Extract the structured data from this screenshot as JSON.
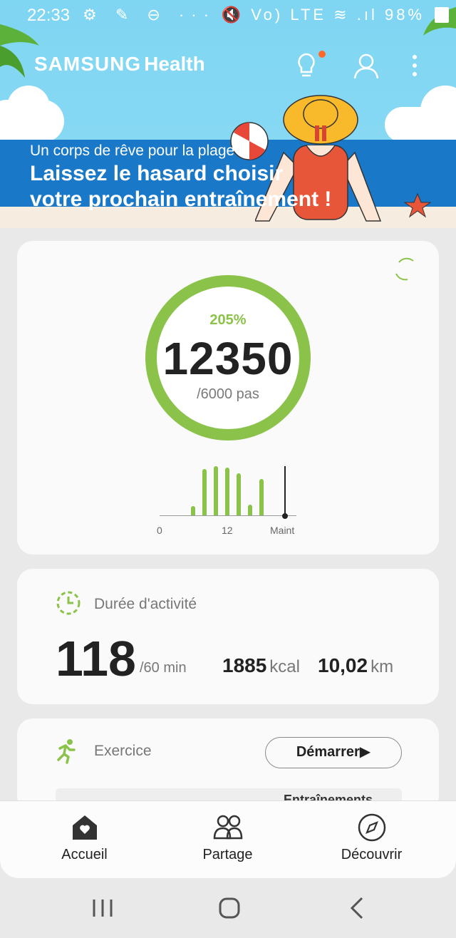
{
  "status_bar": {
    "time": "22:33",
    "left_icons": "⚙ ✎ ⊖ ···",
    "right_icons": "🔇 Vo) LTE ≋ .ıl",
    "battery": "98%"
  },
  "header": {
    "brand": "SAMSUNG",
    "app": "Health",
    "icons": [
      "lightbulb-icon",
      "profile-icon",
      "more-icon"
    ]
  },
  "banner": {
    "subtitle": "Un corps de rêve pour la plage !",
    "title_line1": "Laissez le hasard choisir",
    "title_line2": "votre prochain entraînement !"
  },
  "steps": {
    "percent": "205%",
    "value": "12350",
    "goal": "/6000 pas",
    "progress_fraction": 1.0,
    "ticks": [
      "0",
      "12",
      "Maint"
    ],
    "accent": "#8bc34a"
  },
  "activity": {
    "title": "Durée d'activité",
    "value": "118",
    "goal": "/60 min",
    "kcal_value": "1885",
    "kcal_unit": "kcal",
    "km_value": "10,02",
    "km_unit": "km"
  },
  "exercise": {
    "title": "Exercice",
    "start_label": "Démarrer▶",
    "strip_label": "Entraînements"
  },
  "bottom_nav": [
    {
      "label": "Accueil",
      "icon": "home-icon"
    },
    {
      "label": "Partage",
      "icon": "people-icon"
    },
    {
      "label": "Découvrir",
      "icon": "compass-icon"
    }
  ],
  "system_nav": [
    "recent-apps",
    "home",
    "back"
  ]
}
